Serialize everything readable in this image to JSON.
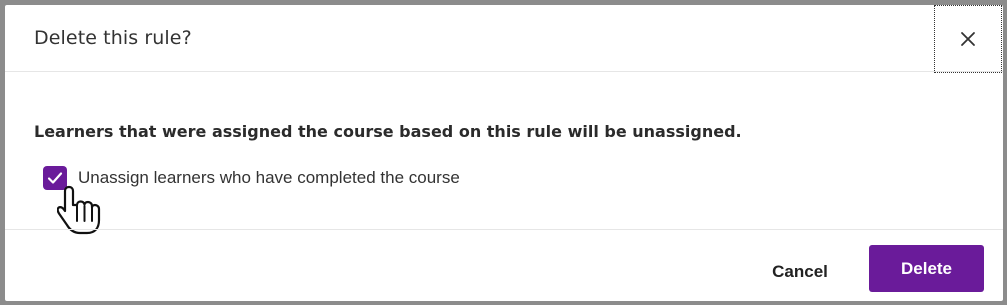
{
  "dialog": {
    "title": "Delete this rule?",
    "close_icon": "close-icon",
    "warning_text": "Learners that were assigned the course based on this rule will be unassigned.",
    "checkbox": {
      "label": "Unassign learners who have completed the course",
      "checked": true,
      "icon": "checkmark-icon"
    },
    "cancel_label": "Cancel",
    "delete_label": "Delete"
  },
  "colors": {
    "accent": "#6a1b9a",
    "backdrop": "#8c8c8c",
    "text": "#333333"
  }
}
